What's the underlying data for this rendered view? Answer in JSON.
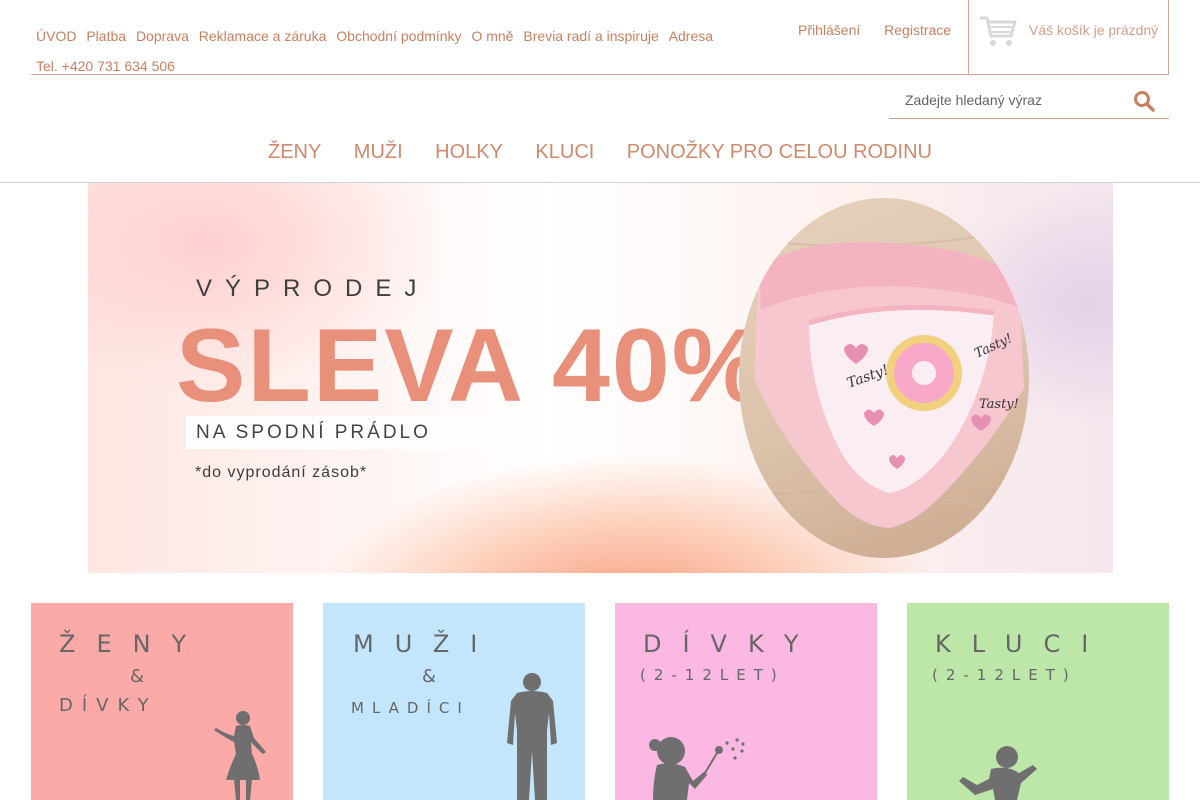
{
  "header": {
    "top_links": [
      "ÚVOD",
      "Platba",
      "Doprava",
      "Reklamace a záruka",
      "Obchodní podmínky",
      "O mně",
      "Brevia radí a inspiruje",
      "Adresa"
    ],
    "phone": "Tel. +420 731 634 506",
    "login_label": "Přihlášení",
    "register_label": "Registrace",
    "cart_label": "Váš košík je prázdný"
  },
  "search": {
    "placeholder": "Zadejte hledaný výraz"
  },
  "main_nav": [
    "ŽENY",
    "MUŽI",
    "HOLKY",
    "KLUCI",
    "PONOŽKY PRO CELOU RODINU"
  ],
  "banner": {
    "kicker": "VÝPRODEJ",
    "headline": "SLEVA 40%",
    "sub": "NA SPODNÍ PRÁDLO",
    "note": "*do vyprodání zásob*",
    "product_print": [
      "Tasty!",
      "Tasty!",
      "Tasty!"
    ]
  },
  "categories": [
    {
      "line1": "ŽENY",
      "amp": "&",
      "line2": "DÍVKY",
      "color": "#fcaaa8"
    },
    {
      "line1": "MUŽI",
      "amp": "&",
      "line2": "MLADÍCI",
      "color": "#c3e6fc"
    },
    {
      "line1": "DÍVKY",
      "line2": "(2-12LET)",
      "color": "#fbb8e2"
    },
    {
      "line1": "KLUCI",
      "line2": "(2-12LET)",
      "color": "#bde7a8"
    }
  ],
  "colors": {
    "accent": "#c9805f",
    "headline": "#e8907a",
    "silhouette": "#6f6f6f"
  },
  "icons": [
    "cart-icon",
    "search-icon"
  ]
}
